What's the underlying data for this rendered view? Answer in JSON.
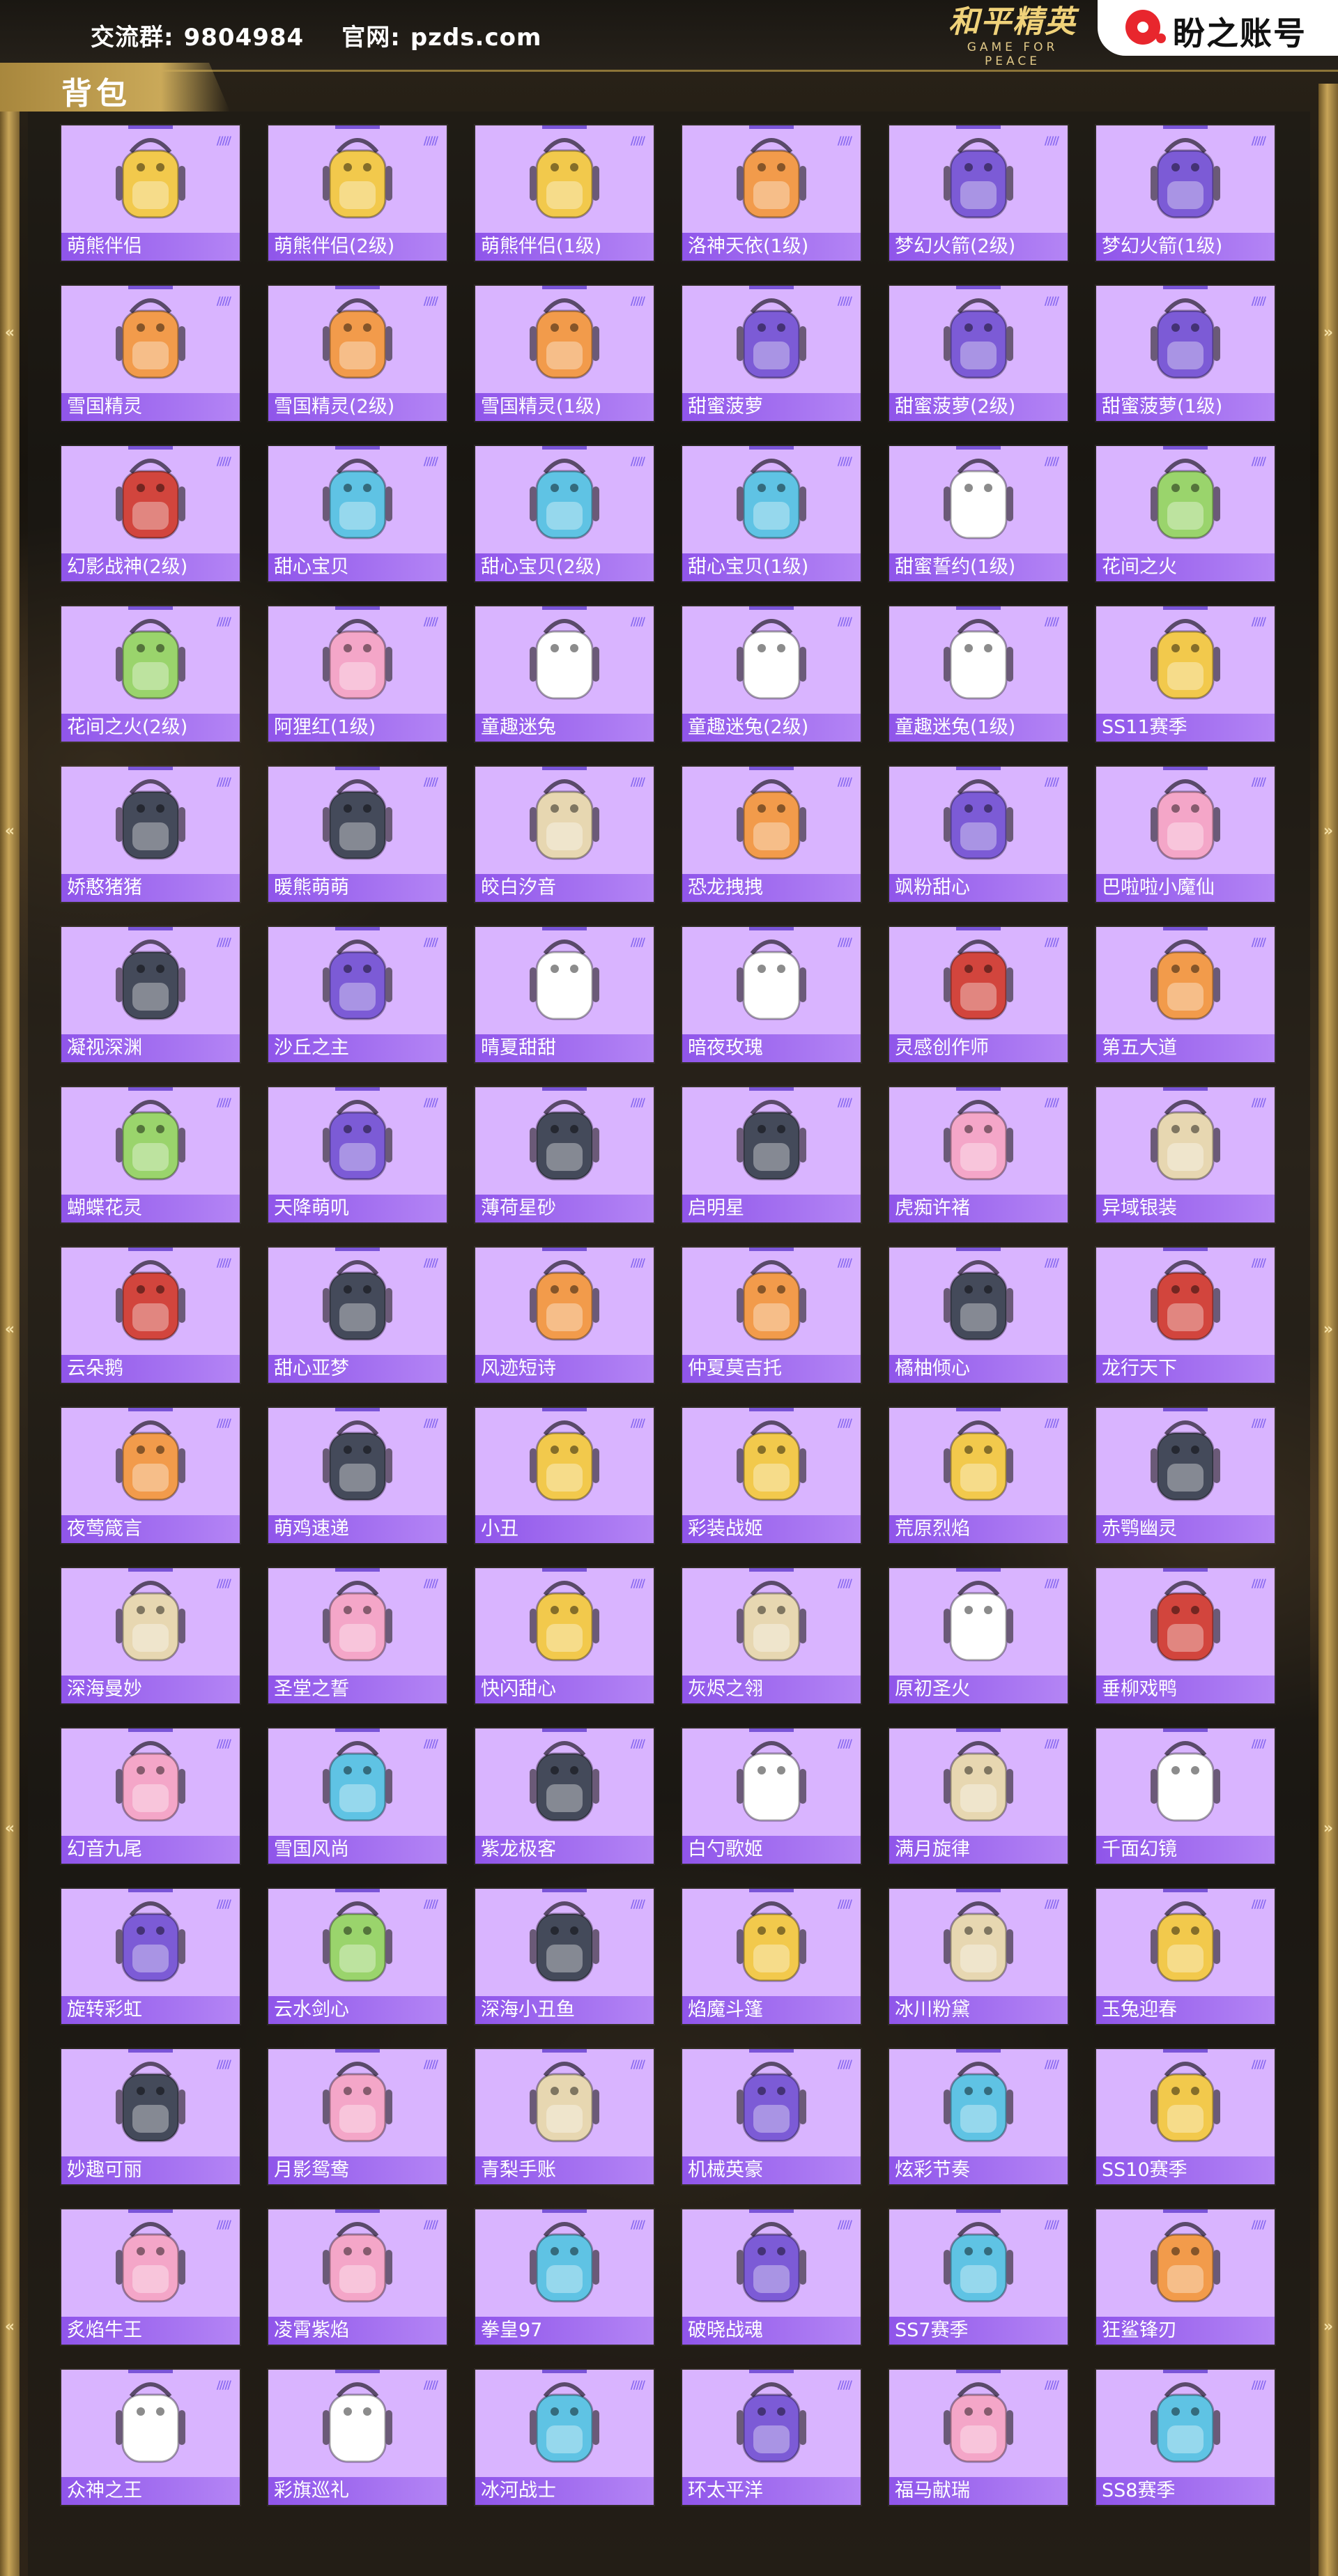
{
  "header": {
    "group_label": "交流群:",
    "group_number": "9804984",
    "site_label": "官网:",
    "site_url": "pzds.com",
    "game_logo_cn": "和平精英",
    "game_logo_en": "GAME FOR PEACE",
    "brand_name": "盼之账号"
  },
  "section": {
    "title": "背包"
  },
  "colors": {
    "card_bg": "#d9b4ff",
    "label_bar": "#8f55ea",
    "gold": "#c8a558",
    "brand_red": "#e8262d"
  },
  "items": [
    {
      "label": "萌熊伴侣",
      "icon": "pink-bear-backpack"
    },
    {
      "label": "萌熊伴侣(2级)",
      "icon": "pink-bear-backpack"
    },
    {
      "label": "萌熊伴侣(1级)",
      "icon": "pink-bear-backpack"
    },
    {
      "label": "洛神天依(1级)",
      "icon": "white-backpack"
    },
    {
      "label": "梦幻火箭(2级)",
      "icon": "rocket-backpack"
    },
    {
      "label": "梦幻火箭(1级)",
      "icon": "rocket-backpack"
    },
    {
      "label": "雪国精灵",
      "icon": "snowman-backpack"
    },
    {
      "label": "雪国精灵(2级)",
      "icon": "snowman-backpack"
    },
    {
      "label": "雪国精灵(1级)",
      "icon": "snowman-backpack"
    },
    {
      "label": "甜蜜菠萝",
      "icon": "pineapple-backpack"
    },
    {
      "label": "甜蜜菠萝(2级)",
      "icon": "pineapple-backpack"
    },
    {
      "label": "甜蜜菠萝(1级)",
      "icon": "pineapple-backpack"
    },
    {
      "label": "幻影战神(2级)",
      "icon": "armor-backpack"
    },
    {
      "label": "甜心宝贝",
      "icon": "cake-backpack"
    },
    {
      "label": "甜心宝贝(2级)",
      "icon": "cake-backpack"
    },
    {
      "label": "甜心宝贝(1级)",
      "icon": "cake-backpack"
    },
    {
      "label": "甜蜜誓约(1级)",
      "icon": "heart-backpack"
    },
    {
      "label": "花间之火",
      "icon": "flower-backpack"
    },
    {
      "label": "花间之火(2级)",
      "icon": "flower-backpack"
    },
    {
      "label": "阿狸红(1级)",
      "icon": "fox-backpack"
    },
    {
      "label": "童趣迷兔",
      "icon": "bunny-backpack"
    },
    {
      "label": "童趣迷兔(2级)",
      "icon": "bunny-backpack"
    },
    {
      "label": "童趣迷兔(1级)",
      "icon": "bunny-backpack"
    },
    {
      "label": "SS11赛季",
      "icon": "striped-backpack"
    },
    {
      "label": "娇憨猪猪",
      "icon": "pig-backpack"
    },
    {
      "label": "暖熊萌萌",
      "icon": "hamster-backpack"
    },
    {
      "label": "皎白汐音",
      "icon": "shell-backpack"
    },
    {
      "label": "恐龙拽拽",
      "icon": "dinosaur-backpack"
    },
    {
      "label": "飒粉甜心",
      "icon": "pink-backpack"
    },
    {
      "label": "巴啦啦小魔仙",
      "icon": "magic-backpack"
    },
    {
      "label": "凝视深渊",
      "icon": "dark-backpack"
    },
    {
      "label": "沙丘之主",
      "icon": "lamp-backpack"
    },
    {
      "label": "晴夏甜甜",
      "icon": "bunny-backpack"
    },
    {
      "label": "暗夜玫瑰",
      "icon": "panda-backpack"
    },
    {
      "label": "灵感创作师",
      "icon": "clown-backpack"
    },
    {
      "label": "第五大道",
      "icon": "handbag-backpack"
    },
    {
      "label": "蝴蝶花灵",
      "icon": "butterfly-backpack"
    },
    {
      "label": "天降萌叽",
      "icon": "yellow-backpack"
    },
    {
      "label": "薄荷星砂",
      "icon": "mint-backpack"
    },
    {
      "label": "启明星",
      "icon": "orange-backpack"
    },
    {
      "label": "虎痴许褚",
      "icon": "tiger-backpack"
    },
    {
      "label": "异域银装",
      "icon": "tech-backpack"
    },
    {
      "label": "云朵鹅",
      "icon": "duck-backpack"
    },
    {
      "label": "甜心亚梦",
      "icon": "dark-backpack"
    },
    {
      "label": "风迹短诗",
      "icon": "white-backpack"
    },
    {
      "label": "仲夏莫吉托",
      "icon": "white-backpack"
    },
    {
      "label": "橘柚倾心",
      "icon": "orange-backpack"
    },
    {
      "label": "龙行天下",
      "icon": "dragon-backpack"
    },
    {
      "label": "夜莺箴言",
      "icon": "bird-backpack"
    },
    {
      "label": "萌鸡速递",
      "icon": "chick-backpack"
    },
    {
      "label": "小丑",
      "icon": "jester-backpack"
    },
    {
      "label": "彩装战姬",
      "icon": "red-backpack"
    },
    {
      "label": "荒原烈焰",
      "icon": "red-backpack"
    },
    {
      "label": "赤鹗幽灵",
      "icon": "dark-backpack"
    },
    {
      "label": "深海曼妙",
      "icon": "tank-backpack"
    },
    {
      "label": "圣堂之誓",
      "icon": "wing-backpack"
    },
    {
      "label": "快闪甜心",
      "icon": "red-backpack"
    },
    {
      "label": "灰烬之翎",
      "icon": "mask-backpack"
    },
    {
      "label": "原初圣火",
      "icon": "gold-backpack"
    },
    {
      "label": "垂柳戏鸭",
      "icon": "duck-backpack"
    },
    {
      "label": "幻音九尾",
      "icon": "fox-backpack"
    },
    {
      "label": "雪国风尚",
      "icon": "penguin-backpack"
    },
    {
      "label": "紫龙极客",
      "icon": "dark-backpack"
    },
    {
      "label": "白勺歌姬",
      "icon": "bunny-backpack"
    },
    {
      "label": "满月旋律",
      "icon": "shell-backpack"
    },
    {
      "label": "千面幻镜",
      "icon": "gold-backpack"
    },
    {
      "label": "旋转彩虹",
      "icon": "pink-backpack"
    },
    {
      "label": "云水剑心",
      "icon": "sword-backpack"
    },
    {
      "label": "深海小丑鱼",
      "icon": "fish-backpack"
    },
    {
      "label": "焰魔斗篷",
      "icon": "red-backpack"
    },
    {
      "label": "冰川粉黛",
      "icon": "shell-backpack"
    },
    {
      "label": "玉兔迎春",
      "icon": "red-backpack"
    },
    {
      "label": "妙趣可丽",
      "icon": "gift-backpack"
    },
    {
      "label": "月影鸳鸯",
      "icon": "wing-backpack"
    },
    {
      "label": "青梨手账",
      "icon": "pear-backpack"
    },
    {
      "label": "机械英豪",
      "icon": "robot-backpack"
    },
    {
      "label": "炫彩节奏",
      "icon": "purple-backpack"
    },
    {
      "label": "SS10赛季",
      "icon": "striped-backpack"
    },
    {
      "label": "炙焰牛王",
      "icon": "bull-backpack"
    },
    {
      "label": "凌霄紫焰",
      "icon": "wing-backpack"
    },
    {
      "label": "拳皇97",
      "icon": "purple-backpack"
    },
    {
      "label": "破晓战魂",
      "icon": "robot-backpack"
    },
    {
      "label": "SS7赛季",
      "icon": "blue-backpack"
    },
    {
      "label": "狂鲨锋刃",
      "icon": "shark-backpack"
    },
    {
      "label": "众神之王",
      "icon": "gold-backpack"
    },
    {
      "label": "彩旗巡礼",
      "icon": "bunny-backpack"
    },
    {
      "label": "冰河战士",
      "icon": "blue-backpack"
    },
    {
      "label": "环太平洋",
      "icon": "robot-backpack"
    },
    {
      "label": "福马献瑞",
      "icon": "horse-backpack"
    },
    {
      "label": "SS8赛季",
      "icon": "blue-backpack"
    }
  ]
}
